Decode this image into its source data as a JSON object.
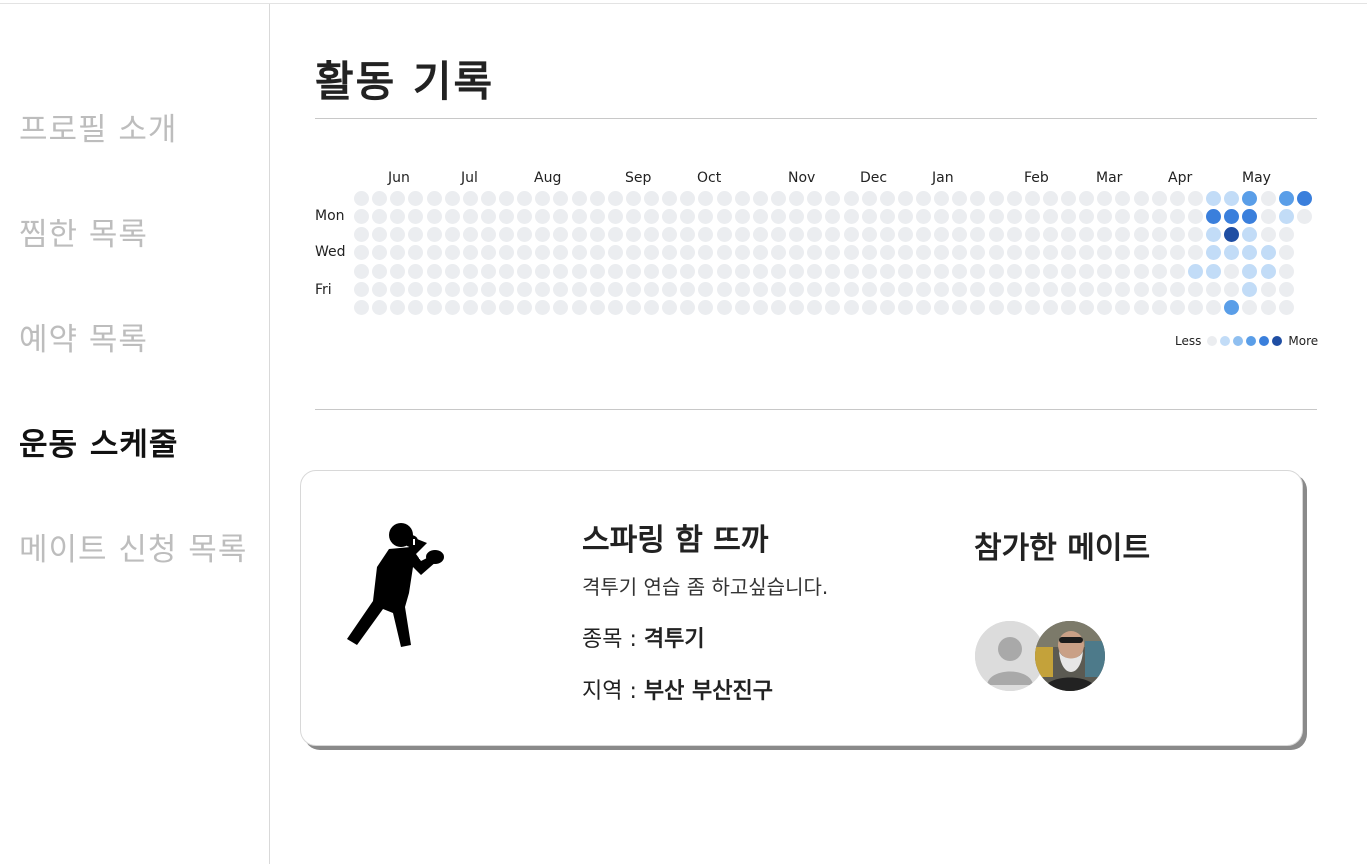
{
  "sidebar": {
    "items": [
      {
        "label": "프로필 소개",
        "active": false
      },
      {
        "label": "찜한 목록",
        "active": false
      },
      {
        "label": "예약 목록",
        "active": false
      },
      {
        "label": "운동 스케줄",
        "active": true
      },
      {
        "label": "메이트 신청 목록",
        "active": false
      }
    ]
  },
  "main": {
    "title": "활동 기록"
  },
  "heatmap": {
    "months": [
      "Jun",
      "Jul",
      "Aug",
      "Sep",
      "Oct",
      "Nov",
      "Dec",
      "Jan",
      "Feb",
      "Mar",
      "Apr",
      "May"
    ],
    "day_labels": [
      "Mon",
      "Wed",
      "Fri"
    ],
    "legend_less": "Less",
    "legend_more": "More",
    "colors": [
      "#ebedf0",
      "#c2dcf7",
      "#8fbff0",
      "#5a9ee8",
      "#3a7fdc",
      "#1f4ea3"
    ],
    "active_cells": [
      {
        "week": 48,
        "day": 0,
        "level": 1
      },
      {
        "week": 49,
        "day": 0,
        "level": 1
      },
      {
        "week": 50,
        "day": 0,
        "level": 3
      },
      {
        "week": 52,
        "day": 0,
        "level": 3
      },
      {
        "week": 53,
        "day": 0,
        "level": 4
      },
      {
        "week": 48,
        "day": 1,
        "level": 4
      },
      {
        "week": 49,
        "day": 1,
        "level": 4
      },
      {
        "week": 50,
        "day": 1,
        "level": 4
      },
      {
        "week": 52,
        "day": 1,
        "level": 1
      },
      {
        "week": 48,
        "day": 2,
        "level": 1
      },
      {
        "week": 49,
        "day": 2,
        "level": 5
      },
      {
        "week": 50,
        "day": 2,
        "level": 1
      },
      {
        "week": 48,
        "day": 3,
        "level": 1
      },
      {
        "week": 49,
        "day": 3,
        "level": 1
      },
      {
        "week": 50,
        "day": 3,
        "level": 1
      },
      {
        "week": 51,
        "day": 3,
        "level": 1
      },
      {
        "week": 47,
        "day": 4,
        "level": 1
      },
      {
        "week": 48,
        "day": 4,
        "level": 1
      },
      {
        "week": 50,
        "day": 4,
        "level": 1
      },
      {
        "week": 51,
        "day": 4,
        "level": 1
      },
      {
        "week": 50,
        "day": 5,
        "level": 1
      },
      {
        "week": 49,
        "day": 6,
        "level": 3
      }
    ]
  },
  "card": {
    "icon": "boxer-icon",
    "title": "스파링 함 뜨까",
    "description": "격투기 연습 좀 하고싶습니다.",
    "category_label": "종목 : ",
    "category_value": "격투기",
    "region_label": "지역 : ",
    "region_value": "부산 부산진구",
    "mates_title": "참가한 메이트",
    "mates": [
      {
        "avatar": "default-avatar-icon"
      },
      {
        "avatar": "user-photo-avatar"
      }
    ]
  }
}
